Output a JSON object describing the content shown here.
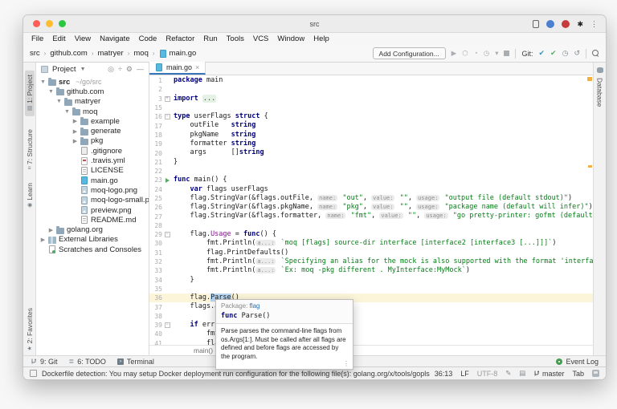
{
  "colors": {
    "accent": "#3875b8",
    "keyword": "#000080",
    "string_green": "#067d17",
    "field_purple": "#871094",
    "hint_bg": "#ebebeb",
    "current_line": "#fcf5da",
    "word_highlight": "#b8d7f3",
    "run_green": "#59a869",
    "git_blue": "#3592c4",
    "error_stripe": "#f4af3d",
    "event_log_green": "#499c54"
  },
  "window": {
    "title": "src"
  },
  "menu": {
    "items": [
      "File",
      "Edit",
      "View",
      "Navigate",
      "Code",
      "Refactor",
      "Run",
      "Tools",
      "VCS",
      "Window",
      "Help"
    ]
  },
  "breadcrumbs": [
    "src",
    "github.com",
    "matryer",
    "moq",
    "main.go"
  ],
  "toolbar": {
    "add_config": "Add Configuration...",
    "git_label": "Git:"
  },
  "left_stripe": {
    "top": [
      "1: Project",
      "7: Structure",
      "Learn"
    ],
    "bottom": [
      "2: Favorites"
    ]
  },
  "right_stripe": {
    "top": [
      "Database"
    ]
  },
  "project_panel": {
    "title": "Project",
    "items": [
      {
        "d": 0,
        "a": "e",
        "icon": "folder",
        "label": "src",
        "suffix": "~/go/src",
        "bold": true
      },
      {
        "d": 1,
        "a": "e",
        "icon": "folder",
        "label": "github.com"
      },
      {
        "d": 2,
        "a": "e",
        "icon": "folder",
        "label": "matryer"
      },
      {
        "d": 3,
        "a": "e",
        "icon": "folder",
        "label": "moq"
      },
      {
        "d": 4,
        "a": "c",
        "icon": "folder",
        "label": "example"
      },
      {
        "d": 4,
        "a": "c",
        "icon": "folder",
        "label": "generate"
      },
      {
        "d": 4,
        "a": "c",
        "icon": "folder",
        "label": "pkg"
      },
      {
        "d": 4,
        "a": null,
        "icon": "git",
        "label": ".gitignore"
      },
      {
        "d": 4,
        "a": null,
        "icon": "yaml",
        "label": ".travis.yml"
      },
      {
        "d": 4,
        "a": null,
        "icon": "text",
        "label": "LICENSE"
      },
      {
        "d": 4,
        "a": null,
        "icon": "go",
        "label": "main.go"
      },
      {
        "d": 4,
        "a": null,
        "icon": "image",
        "label": "moq-logo.png"
      },
      {
        "d": 4,
        "a": null,
        "icon": "image",
        "label": "moq-logo-small.png"
      },
      {
        "d": 4,
        "a": null,
        "icon": "image",
        "label": "preview.png"
      },
      {
        "d": 4,
        "a": null,
        "icon": "markdown",
        "label": "README.md"
      },
      {
        "d": 1,
        "a": "c",
        "icon": "folder",
        "label": "golang.org"
      },
      {
        "d": 0,
        "a": "c",
        "icon": "libraries",
        "label": "External Libraries"
      },
      {
        "d": 0,
        "a": null,
        "icon": "scratches",
        "label": "Scratches and Consoles"
      }
    ]
  },
  "editor": {
    "tab_label": "main.go",
    "breadcrumb": "main()",
    "lines": [
      {
        "n": 1,
        "t": [
          [
            "k",
            "package"
          ],
          [
            "p",
            " main"
          ]
        ]
      },
      {
        "n": 2,
        "t": []
      },
      {
        "n": 3,
        "m": "plus",
        "t": [
          [
            "k",
            "import"
          ],
          [
            "p",
            " "
          ],
          [
            "f",
            "..."
          ]
        ]
      },
      {
        "n": 15,
        "t": []
      },
      {
        "n": 16,
        "m": "minus",
        "t": [
          [
            "k",
            "type"
          ],
          [
            "p",
            " userFlags "
          ],
          [
            "k",
            "struct"
          ],
          [
            "p",
            " {"
          ]
        ]
      },
      {
        "n": 17,
        "t": [
          [
            "p",
            "    outFile   "
          ],
          [
            "k",
            "string"
          ]
        ]
      },
      {
        "n": 18,
        "t": [
          [
            "p",
            "    pkgName   "
          ],
          [
            "k",
            "string"
          ]
        ]
      },
      {
        "n": 19,
        "t": [
          [
            "p",
            "    formatter "
          ],
          [
            "k",
            "string"
          ]
        ]
      },
      {
        "n": 20,
        "t": [
          [
            "p",
            "    args      []"
          ],
          [
            "k",
            "string"
          ]
        ]
      },
      {
        "n": 21,
        "t": [
          [
            "p",
            "}"
          ]
        ]
      },
      {
        "n": 22,
        "t": []
      },
      {
        "n": 23,
        "m": "run",
        "t": [
          [
            "k",
            "func"
          ],
          [
            "p",
            " main() {"
          ]
        ]
      },
      {
        "n": 24,
        "t": [
          [
            "p",
            "    "
          ],
          [
            "k",
            "var"
          ],
          [
            "p",
            " flags userFlags"
          ]
        ]
      },
      {
        "n": 25,
        "t": [
          [
            "p",
            "    flag.StringVar(&flags.outFile, "
          ],
          [
            "h",
            "name:"
          ],
          [
            "p",
            " "
          ],
          [
            "s",
            "\"out\""
          ],
          [
            "p",
            ", "
          ],
          [
            "h",
            "value:"
          ],
          [
            "p",
            " "
          ],
          [
            "s",
            "\"\""
          ],
          [
            "p",
            ", "
          ],
          [
            "h",
            "usage:"
          ],
          [
            "p",
            " "
          ],
          [
            "s",
            "\"output file (default stdout)\""
          ],
          [
            "p",
            ")"
          ]
        ]
      },
      {
        "n": 26,
        "t": [
          [
            "p",
            "    flag.StringVar(&flags.pkgName, "
          ],
          [
            "h",
            "name:"
          ],
          [
            "p",
            " "
          ],
          [
            "s",
            "\"pkg\""
          ],
          [
            "p",
            ", "
          ],
          [
            "h",
            "value:"
          ],
          [
            "p",
            " "
          ],
          [
            "s",
            "\"\""
          ],
          [
            "p",
            ", "
          ],
          [
            "h",
            "usage:"
          ],
          [
            "p",
            " "
          ],
          [
            "s",
            "\"package name (default will infer)\""
          ],
          [
            "p",
            ")"
          ]
        ]
      },
      {
        "n": 27,
        "t": [
          [
            "p",
            "    flag.StringVar(&flags.formatter, "
          ],
          [
            "h",
            "name:"
          ],
          [
            "p",
            " "
          ],
          [
            "s",
            "\"fmt\""
          ],
          [
            "p",
            ", "
          ],
          [
            "h",
            "value:"
          ],
          [
            "p",
            " "
          ],
          [
            "s",
            "\"\""
          ],
          [
            "p",
            ", "
          ],
          [
            "h",
            "usage:"
          ],
          [
            "p",
            " "
          ],
          [
            "s",
            "\"go pretty-printer: gofmt (default) or "
          ],
          [
            "su",
            "goimports"
          ],
          [
            "s",
            "\""
          ],
          [
            "p",
            ")"
          ]
        ]
      },
      {
        "n": 28,
        "t": []
      },
      {
        "n": 29,
        "m": "minus",
        "t": [
          [
            "p",
            "    flag."
          ],
          [
            "fld",
            "Usage"
          ],
          [
            "p",
            " = "
          ],
          [
            "k",
            "func"
          ],
          [
            "p",
            "() {"
          ]
        ]
      },
      {
        "n": 30,
        "t": [
          [
            "p",
            "        fmt.Println("
          ],
          [
            "h",
            "a...:"
          ],
          [
            "p",
            " "
          ],
          [
            "s",
            "`moq [flags] source-dir interface [interface2 [interface3 [...]]]`"
          ],
          [
            "p",
            ")"
          ]
        ]
      },
      {
        "n": 31,
        "t": [
          [
            "p",
            "        flag.PrintDefaults()"
          ]
        ]
      },
      {
        "n": 32,
        "t": [
          [
            "p",
            "        fmt.Println("
          ],
          [
            "h",
            "a...:"
          ],
          [
            "p",
            " "
          ],
          [
            "s",
            "`Specifying an alias for the mock is also supported with the format 'interface:alias'`"
          ],
          [
            "p",
            ")"
          ]
        ]
      },
      {
        "n": 33,
        "t": [
          [
            "p",
            "        fmt.Println("
          ],
          [
            "h",
            "a...:"
          ],
          [
            "p",
            " "
          ],
          [
            "s",
            "`Ex: moq -pkg different . MyInterface:MyMock`"
          ],
          [
            "p",
            ")"
          ]
        ]
      },
      {
        "n": 34,
        "t": [
          [
            "p",
            "    }"
          ]
        ]
      },
      {
        "n": 35,
        "t": []
      },
      {
        "n": 36,
        "hl": true,
        "t": [
          [
            "p",
            "    flag."
          ],
          [
            "w",
            "Par"
          ],
          [
            "caret",
            ""
          ],
          [
            "w",
            "se"
          ],
          [
            "p",
            "()"
          ]
        ]
      },
      {
        "n": 37,
        "t": [
          [
            "p",
            "    flags.args = flag.Args()"
          ]
        ]
      },
      {
        "n": 38,
        "t": []
      },
      {
        "n": 39,
        "m": "minus",
        "t": [
          [
            "p",
            "    "
          ],
          [
            "k",
            "if"
          ],
          [
            "p",
            " err := run(flags); err != nil {"
          ]
        ]
      },
      {
        "n": 40,
        "t": [
          [
            "p",
            "        fmt.Fprintln(os.Stderr, err)"
          ]
        ]
      },
      {
        "n": 41,
        "t": [
          [
            "p",
            "        flag.Usage()"
          ]
        ]
      }
    ]
  },
  "tooltip": {
    "package_label": "Package:",
    "package_name": "flag",
    "sig_keyword": "func",
    "sig_rest": " Parse()",
    "body": "Parse parses the command-line flags from os.Args[1:]. Must be called after all flags are defined and before flags are accessed by the program."
  },
  "bottom_bar": {
    "items": [
      {
        "label": "9: Git"
      },
      {
        "label": "6: TODO"
      },
      {
        "label": "Terminal"
      }
    ],
    "event_log": "Event Log"
  },
  "status_bar": {
    "message": "Dockerfile detection: You may setup Docker deployment run configuration for the following file(s): golang.org/x/tools/gopls/integration/gov..",
    "position": "36:13",
    "line_separator": "LF",
    "encoding": "UTF-8",
    "branch": "master",
    "indent": "Tab"
  }
}
